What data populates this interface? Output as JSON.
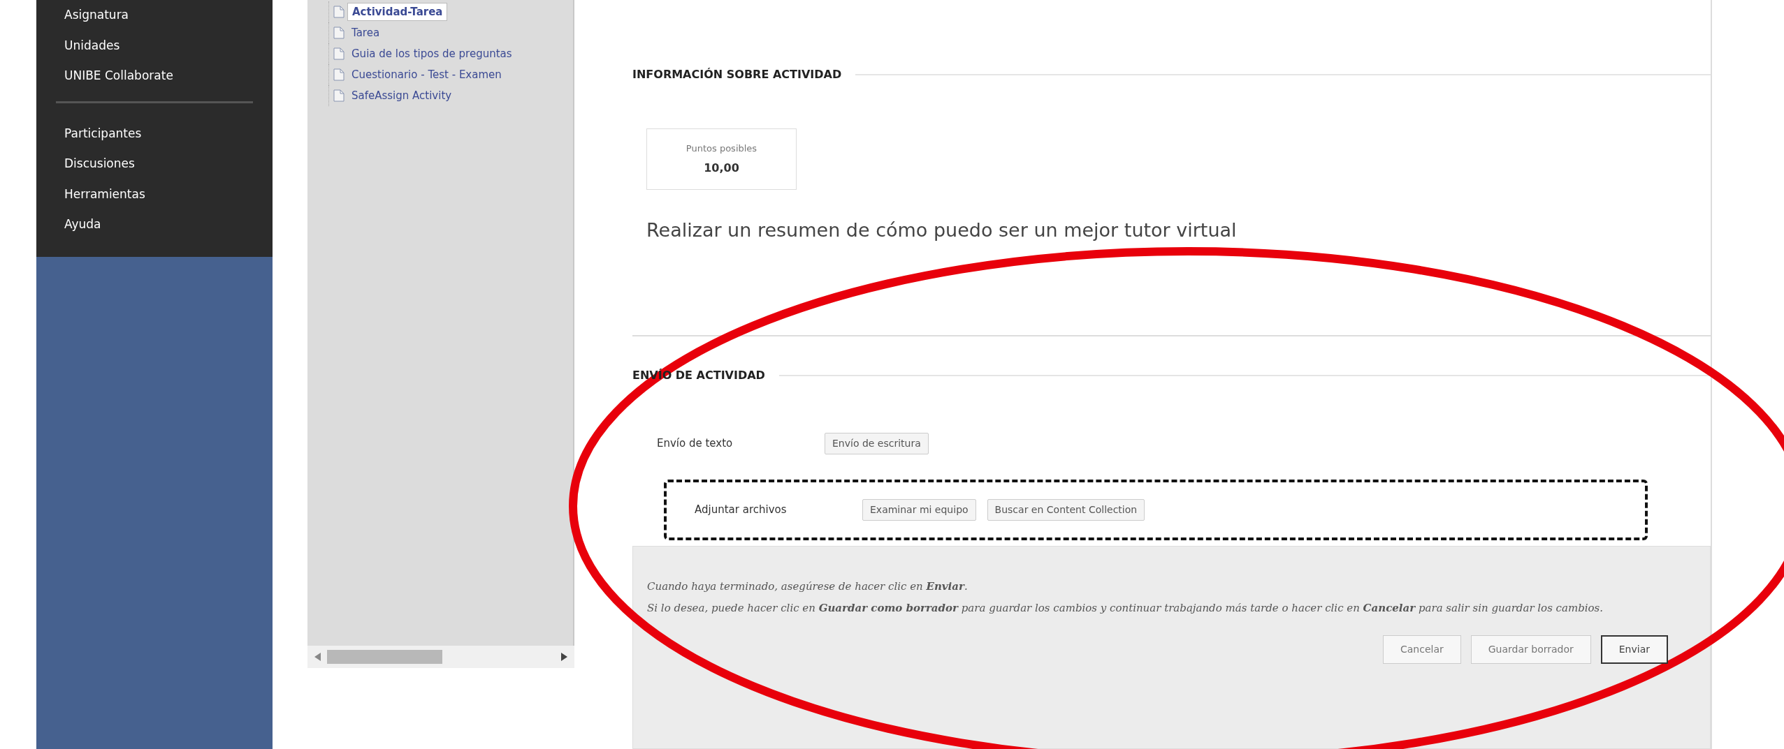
{
  "sidebar": {
    "groups": [
      {
        "items": [
          {
            "label": "Asignatura"
          },
          {
            "label": "Unidades"
          },
          {
            "label": "UNIBE Collaborate"
          }
        ]
      },
      {
        "items": [
          {
            "label": "Participantes"
          },
          {
            "label": "Discusiones"
          },
          {
            "label": "Herramientas"
          },
          {
            "label": "Ayuda"
          }
        ]
      }
    ]
  },
  "tree": {
    "items": [
      {
        "label": "Actividad-Tarea",
        "selected": true
      },
      {
        "label": "Tarea",
        "selected": false
      },
      {
        "label": "Guia de los tipos de preguntas",
        "selected": false
      },
      {
        "label": "Cuestionario - Test - Examen",
        "selected": false
      },
      {
        "label": "SafeAssign Activity",
        "selected": false
      }
    ]
  },
  "info_section": {
    "heading": "INFORMACIÓN SOBRE ACTIVIDAD",
    "points": {
      "label": "Puntos posibles",
      "value": "10,00"
    },
    "description": "Realizar un resumen de cómo puedo ser un mejor tutor virtual"
  },
  "submission_section": {
    "heading": "ENVÍO DE ACTIVIDAD",
    "rows": [
      {
        "label": "Envío de texto",
        "buttons": [
          "Envío de escritura"
        ],
        "highlighted": false
      },
      {
        "label": "Adjuntar archivos",
        "buttons": [
          "Examinar mi equipo",
          "Buscar en Content Collection"
        ],
        "highlighted": true
      }
    ]
  },
  "footer": {
    "lines": [
      "Cuando haya terminado, asegúrese de hacer clic en **Enviar**.",
      "Si lo desea, puede hacer clic en **Guardar como borrador** para guardar los cambios y continuar trabajando más tarde o hacer clic en **Cancelar** para salir sin guardar los cambios."
    ],
    "buttons": [
      {
        "label": "Cancelar",
        "primary": false
      },
      {
        "label": "Guardar borrador",
        "primary": false
      },
      {
        "label": "Enviar",
        "primary": true
      }
    ]
  },
  "annotations": [
    {
      "kind": "ellipse",
      "color": "#e8000b"
    }
  ]
}
